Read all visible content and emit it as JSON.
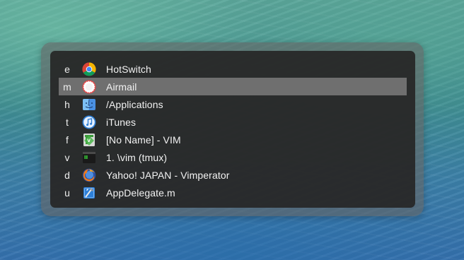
{
  "switcher": {
    "selected_index": 1,
    "items": [
      {
        "key": "e",
        "title": "HotSwitch",
        "icon": "chrome-icon"
      },
      {
        "key": "m",
        "title": "Airmail",
        "icon": "airmail-icon"
      },
      {
        "key": "h",
        "title": "/Applications",
        "icon": "finder-icon"
      },
      {
        "key": "t",
        "title": "iTunes",
        "icon": "itunes-icon"
      },
      {
        "key": "f",
        "title": "[No Name] - VIM",
        "icon": "macvim-icon"
      },
      {
        "key": "v",
        "title": "1. \\vim (tmux)",
        "icon": "iterm-icon"
      },
      {
        "key": "d",
        "title": "Yahoo! JAPAN - Vimperator",
        "icon": "firefox-icon"
      },
      {
        "key": "u",
        "title": "AppDelegate.m",
        "icon": "xcode-icon"
      }
    ]
  },
  "colors": {
    "panel_background": "#262626",
    "selection": "#6f6f6f",
    "text": "#f2f2f2"
  }
}
